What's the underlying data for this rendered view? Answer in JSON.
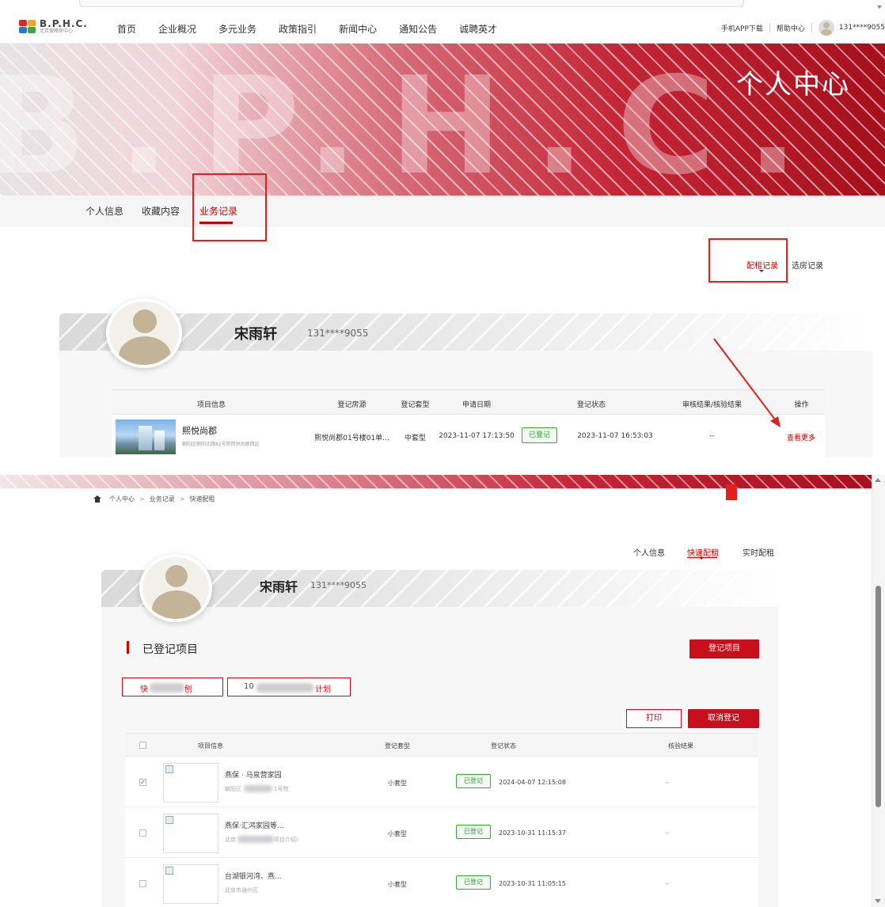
{
  "colors": {
    "accent": "#c8101c",
    "annotation": "#e02020",
    "success": "#2e9a2e"
  },
  "header": {
    "logo_text": "B.P.H.C.",
    "logo_subtext": "北京保障房中心",
    "nav": [
      "首页",
      "企业概况",
      "多元业务",
      "政策指引",
      "新闻中心",
      "通知公告",
      "诚聘英才"
    ],
    "app_download": "手机APP下载",
    "help_center": "帮助中心",
    "user_phone": "131****9055"
  },
  "banner": {
    "watermark": "B.P.H.C.",
    "title": "个人中心"
  },
  "tabs": [
    {
      "label": "个人信息",
      "active": false
    },
    {
      "label": "收藏内容",
      "active": false
    },
    {
      "label": "业务记录",
      "active": true
    }
  ],
  "record_tabs": [
    {
      "label": "配租记录",
      "active": true
    },
    {
      "label": "选房记录",
      "active": false
    }
  ],
  "profile": {
    "name": "宋雨轩",
    "phone": "131****9055"
  },
  "rental_table": {
    "headers": [
      "项目信息",
      "登记房源",
      "登记套型",
      "申请日期",
      "登记状态",
      "审核结果/核验结果",
      "操作"
    ],
    "rows": [
      {
        "title": "熙悦尚郡",
        "address": "朝阳区朝阳北路82号院熙悦尚郡西区",
        "listing": "熙悦尚郡01号楼01单...",
        "unit_type": "中套型",
        "apply_date": "2023-11-07 17:13:50",
        "status": "已登记",
        "status_time": "2023-11-07 16:53:03",
        "result": "--",
        "action": "查看更多"
      }
    ]
  },
  "breadcrumb": [
    "个人中心",
    ">",
    "业务记录",
    ">",
    "快速配租"
  ],
  "sub_tabs": [
    {
      "label": "个人信息",
      "active": false
    },
    {
      "label": "快速配租",
      "active": true
    },
    {
      "label": "实时配租",
      "active": false
    }
  ],
  "registered": {
    "title": "已登记项目",
    "register_button": "登记项目",
    "plan_tabs": [
      "快",
      "刨",
      "10",
      "计划"
    ],
    "print_button": "打印",
    "cancel_button": "取消登记",
    "headers": [
      "项目信息",
      "登记套型",
      "登记状态",
      "核验结果"
    ],
    "rows": [
      {
        "checked": true,
        "title": "燕保 · 马泉营家园",
        "sub_left": "朝阳区",
        "sub_right": "1号院",
        "unit_type": "小套型",
        "status": "已登记",
        "time": "2024-04-07 12:15:08",
        "result": "--"
      },
      {
        "checked": false,
        "title": "燕保·汇鸿家园等...",
        "sub_left": "北京",
        "sub_right": "项目介绍)",
        "unit_type": "小套型",
        "status": "已登记",
        "time": "2023-10-31 11:15:37",
        "result": "--"
      },
      {
        "checked": false,
        "title": "台湖银河湾、燕...",
        "sub_left": "北京市通州区",
        "sub_right": "",
        "unit_type": "小套型",
        "status": "已登记",
        "time": "2023-10-31 11:05:15",
        "result": "--"
      }
    ]
  }
}
